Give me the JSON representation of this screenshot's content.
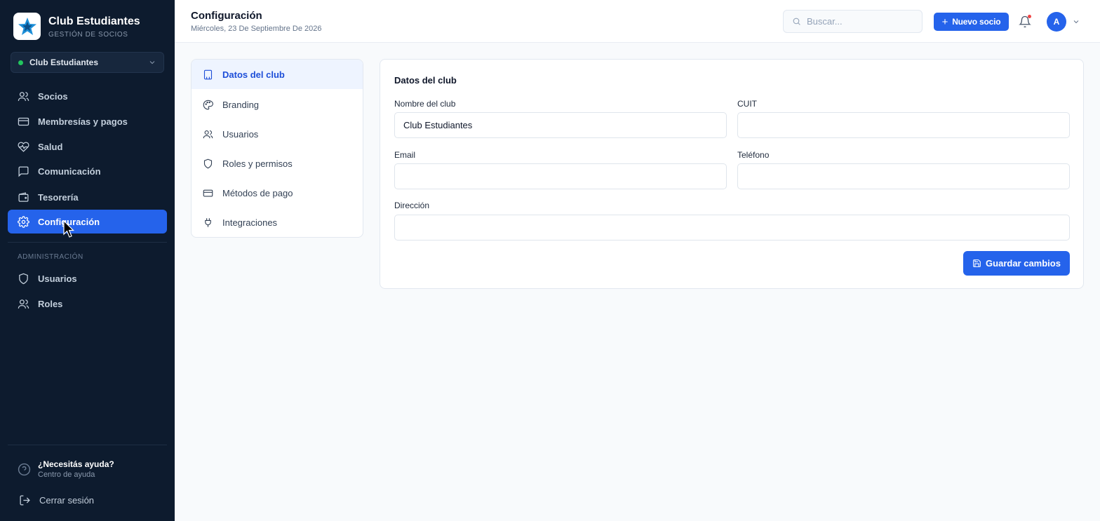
{
  "brand": {
    "name": "Club Estudiantes",
    "subtitle": "GESTIÓN DE SOCIOS"
  },
  "club_selector": {
    "value": "Club Estudiantes"
  },
  "sidebar": {
    "items": [
      {
        "label": "Socios",
        "icon": "users-icon"
      },
      {
        "label": "Membresías y pagos",
        "icon": "credit-card-icon"
      },
      {
        "label": "Salud",
        "icon": "heart-pulse-icon"
      },
      {
        "label": "Comunicación",
        "icon": "message-icon"
      },
      {
        "label": "Tesorería",
        "icon": "wallet-icon"
      },
      {
        "label": "Configuración",
        "icon": "gear-icon",
        "active": true
      }
    ],
    "admin_section": "ADMINISTRACIÓN",
    "admin_items": [
      {
        "label": "Usuarios",
        "icon": "shield-icon"
      },
      {
        "label": "Roles",
        "icon": "users-icon"
      }
    ],
    "help_title": "¿Necesitás ayuda?",
    "help_subtitle": "Centro de ayuda",
    "logout": "Cerrar sesión"
  },
  "header": {
    "title": "Configuración",
    "date": "Miércoles, 23 De Septiembre De 2026",
    "search_placeholder": "Buscar...",
    "new_member_label": "Nuevo socio",
    "avatar_initial": "A"
  },
  "settings_menu": {
    "items": [
      {
        "label": "Datos del club",
        "icon": "building-icon",
        "active": true
      },
      {
        "label": "Branding",
        "icon": "palette-icon"
      },
      {
        "label": "Usuarios",
        "icon": "users-icon"
      },
      {
        "label": "Roles y permisos",
        "icon": "shield-icon"
      },
      {
        "label": "Métodos de pago",
        "icon": "credit-card-icon"
      },
      {
        "label": "Integraciones",
        "icon": "plug-icon"
      }
    ]
  },
  "form": {
    "title": "Datos del club",
    "fields": {
      "name": {
        "label": "Nombre del club",
        "value": "Club Estudiantes"
      },
      "cuit": {
        "label": "CUIT",
        "value": ""
      },
      "email": {
        "label": "Email",
        "value": ""
      },
      "phone": {
        "label": "Teléfono",
        "value": ""
      },
      "address": {
        "label": "Dirección",
        "value": ""
      }
    },
    "save_label": "Guardar cambios"
  },
  "colors": {
    "sidebar_bg": "#0d1b2e",
    "accent": "#2563eb",
    "status_dot": "#22c55e"
  }
}
